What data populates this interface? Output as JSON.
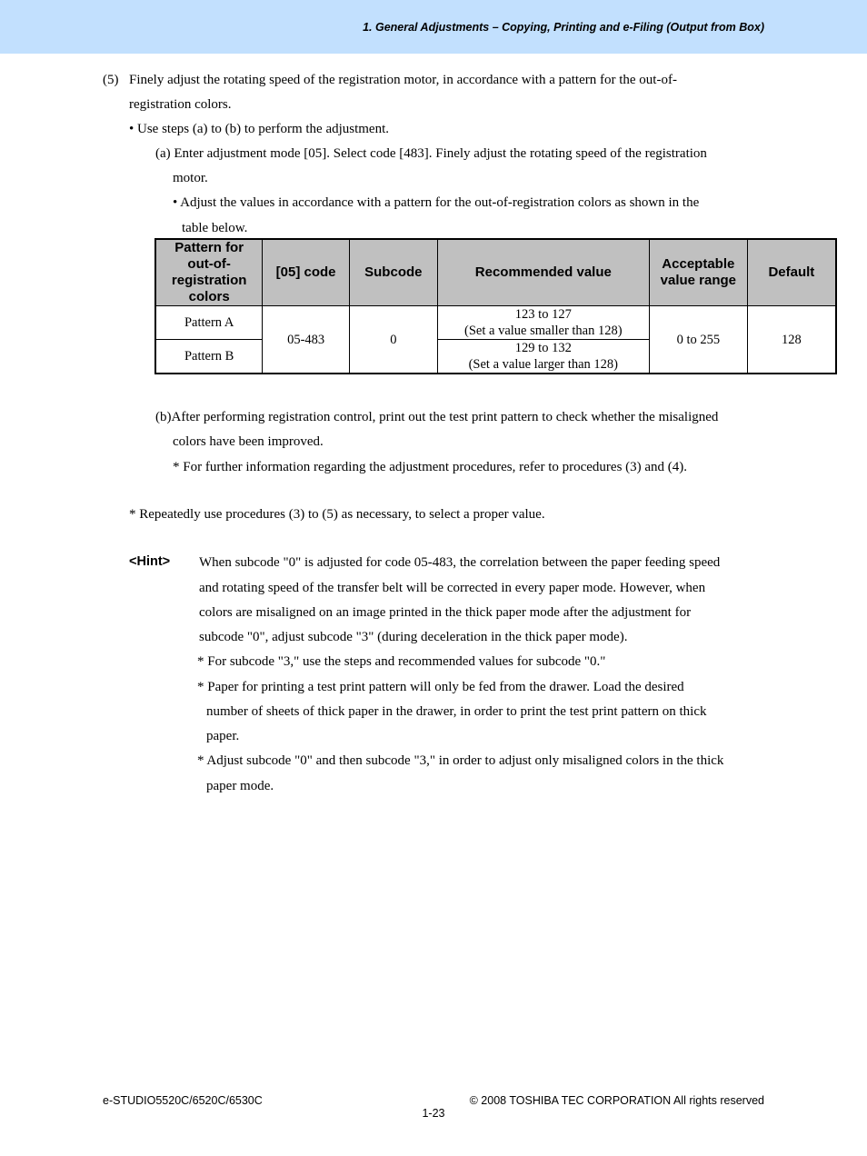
{
  "header": {
    "title": "1. General Adjustments – Copying, Printing and e-Filing (Output from Box)",
    "band_color": "#c2e0fe"
  },
  "step5": {
    "number": "(5)",
    "line1": "Finely adjust the rotating speed of the registration motor, in accordance with a pattern for the out-of-",
    "line2": "registration colors.",
    "bullet": "• Use steps (a) to (b) to perform the adjustment.",
    "a_line1": "(a) Enter adjustment mode [05].  Select code [483].  Finely adjust the rotating speed of the registration",
    "a_line2": "motor.",
    "a_bullet_line1": "• Adjust the values in accordance with a pattern for the out-of-registration colors as shown in the",
    "a_bullet_line2": "table below."
  },
  "table": {
    "headers": {
      "pattern": "Pattern for out-of- registration colors",
      "code": "[05] code",
      "subcode": "Subcode",
      "recommended": "Recommended value",
      "range": "Acceptable value range",
      "default": "Default"
    },
    "header_lines": {
      "pattern": [
        "Pattern for",
        "out-of-",
        "registration",
        "colors"
      ],
      "range": [
        "Acceptable",
        "value range"
      ]
    },
    "rows": [
      {
        "pattern": "Pattern A",
        "recommended_1": "123 to 127",
        "recommended_2": "(Set a value smaller than 128)"
      },
      {
        "pattern": "Pattern B",
        "recommended_1": "129 to 132",
        "recommended_2": "(Set a value larger than 128)"
      }
    ],
    "shared": {
      "code": "05-483",
      "subcode": "0",
      "range": "0 to 255",
      "default": "128"
    }
  },
  "step_b": {
    "line1": "(b)After performing registration control, print out the test print pattern to check whether the misaligned",
    "line2": "colors have been improved.",
    "note": "* For further information regarding the adjustment procedures, refer to procedures (3) and (4)."
  },
  "repeat_note": "* Repeatedly use procedures (3) to (5) as necessary, to select a proper value.",
  "hint": {
    "label": "<Hint>",
    "lines": [
      "When subcode \"0\" is adjusted for code 05-483, the correlation between the paper feeding speed",
      "and rotating speed of the transfer belt will be corrected in every paper mode.  However, when",
      "colors are misaligned on an image printed in the thick paper mode after the adjustment for",
      "subcode \"0\", adjust subcode \"3\" (during deceleration in the thick paper mode)."
    ],
    "notes": [
      {
        "lines": [
          "* For subcode \"3,\" use the steps and recommended values for subcode \"0.\""
        ]
      },
      {
        "lines": [
          "* Paper for printing a test print pattern will only be fed from the drawer.  Load the desired",
          "number of sheets of thick paper in the drawer, in order to print the test print pattern on thick",
          "paper."
        ]
      },
      {
        "lines": [
          "* Adjust subcode \"0\" and then subcode \"3,\" in order to adjust only misaligned colors in the thick",
          "paper mode."
        ]
      }
    ]
  },
  "footer": {
    "model": "e-STUDIO5520C/6520C/6530C",
    "copyright": "© 2008 TOSHIBA TEC CORPORATION All rights reserved",
    "page": "1-23"
  }
}
